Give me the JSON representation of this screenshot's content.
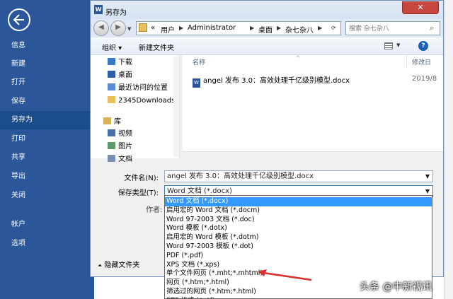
{
  "backstage": {
    "nav": [
      "信息",
      "新建",
      "打开",
      "保存",
      "另存为",
      "打印",
      "共享",
      "导出",
      "关闭",
      "帐户",
      "选项"
    ],
    "active": "另存为"
  },
  "dialog": {
    "title": "另存为",
    "close_glyph": "✕",
    "breadcrumb": [
      "«",
      "用户",
      "Administrator",
      "桌面",
      "杂七杂八"
    ],
    "search_placeholder": "搜索 杂七杂八",
    "toolbar": {
      "organize": "组织 ▾",
      "new_folder": "新建文件夹"
    },
    "nav_pane": {
      "favorites": [
        {
          "label": "下载",
          "icon": "download-icon"
        },
        {
          "label": "桌面",
          "icon": "desktop-icon"
        },
        {
          "label": "最近访问的位置",
          "icon": "recent-places-icon"
        },
        {
          "label": "2345Downloads",
          "icon": "folder-icon"
        }
      ],
      "library": {
        "label": "库",
        "icon": "library-icon"
      },
      "library_items": [
        {
          "label": "视频",
          "icon": "video-icon"
        },
        {
          "label": "图片",
          "icon": "pictures-icon"
        },
        {
          "label": "文档",
          "icon": "documents-icon"
        }
      ]
    },
    "file_list": {
      "col_name": "名称",
      "col_date": "修改日",
      "files": [
        {
          "name": "angel 发布 3.0：高效处理千亿级别模型.docx",
          "date": "2019/8"
        }
      ]
    },
    "filename_label": "文件名(N):",
    "filename_value": "angel 发布 3.0：高效处理千亿级别模型.docx",
    "filetype_label": "保存类型(T):",
    "filetype_value": "Word 文档 (*.docx)",
    "author_label": "作者:",
    "hide_folders": "隐藏文件夹",
    "filetype_options": [
      "Word 文档 (*.docx)",
      "启用宏的 Word 文档 (*.docm)",
      "Word 97-2003 文档 (*.doc)",
      "Word 模板 (*.dotx)",
      "启用宏的 Word 模板 (*.dotm)",
      "Word 97-2003 模板 (*.dot)",
      "PDF (*.pdf)",
      "XPS 文档 (*.xps)",
      "单个文件网页 (*.mht;*.mhtml)",
      "网页 (*.htm;*.html)",
      "筛选过的网页 (*.htm;*.html)",
      "RTF 格式 (*.rtf)"
    ],
    "selected_option": 0,
    "highlighted_option": 8
  },
  "annotation_color": "#d9302c",
  "watermark": "头条 @中新视讯"
}
